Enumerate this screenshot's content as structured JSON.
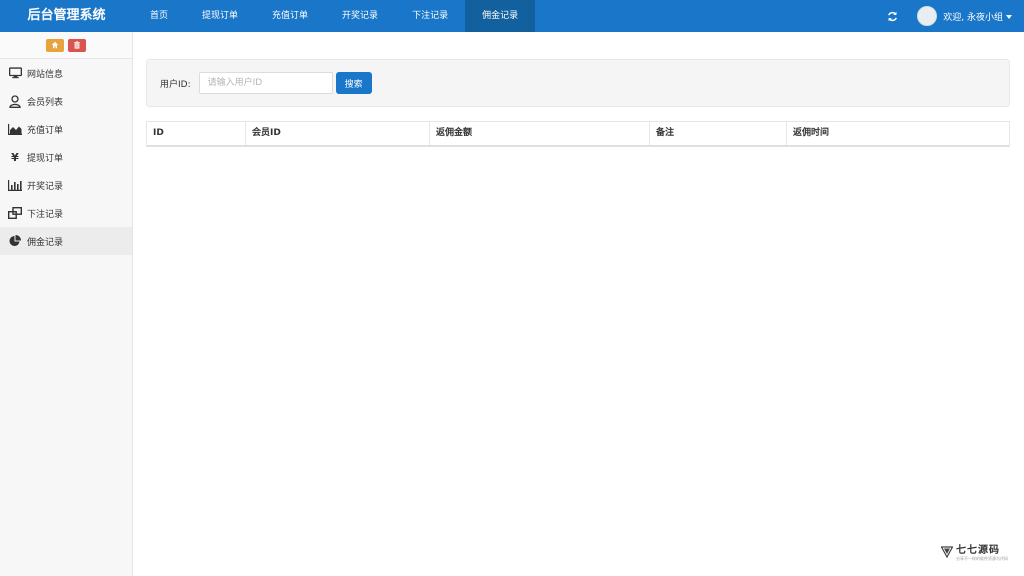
{
  "app": {
    "title": "后台管理系统"
  },
  "nav": [
    {
      "label": "首页"
    },
    {
      "label": "提现订单"
    },
    {
      "label": "充值订单"
    },
    {
      "label": "开奖记录"
    },
    {
      "label": "下注记录"
    },
    {
      "label": "佣金记录",
      "active": true
    }
  ],
  "user": {
    "welcome": "欢迎, 永夜小组"
  },
  "icons": {
    "refresh": "refresh-icon",
    "home": "home-icon",
    "trash": "trash-icon",
    "user_dropdown": "caret-down-icon"
  },
  "colors": {
    "primary": "#1a76c8",
    "active_nav": "#13609f",
    "home_btn": "#e8a33d",
    "trash_btn": "#d9534f"
  },
  "sidebar": {
    "items": [
      {
        "label": "网站信息",
        "icon": "monitor-icon"
      },
      {
        "label": "会员列表",
        "icon": "user-icon"
      },
      {
        "label": "充值订单",
        "icon": "area-chart-icon"
      },
      {
        "label": "提现订单",
        "icon": "yen-icon"
      },
      {
        "label": "开奖记录",
        "icon": "bar-chart-icon"
      },
      {
        "label": "下注记录",
        "icon": "clone-icon"
      },
      {
        "label": "佣金记录",
        "icon": "pie-chart-icon",
        "active": true
      }
    ]
  },
  "search": {
    "label": "用户ID:",
    "placeholder": "请输入用户ID",
    "value": "",
    "button": "搜索"
  },
  "table": {
    "columns": [
      "ID",
      "会员ID",
      "返佣金额",
      "备注",
      "返佣时间"
    ],
    "rows": []
  },
  "watermark": {
    "title": "七七源码",
    "subtitle": "分享不一样的软件资源与代码"
  }
}
